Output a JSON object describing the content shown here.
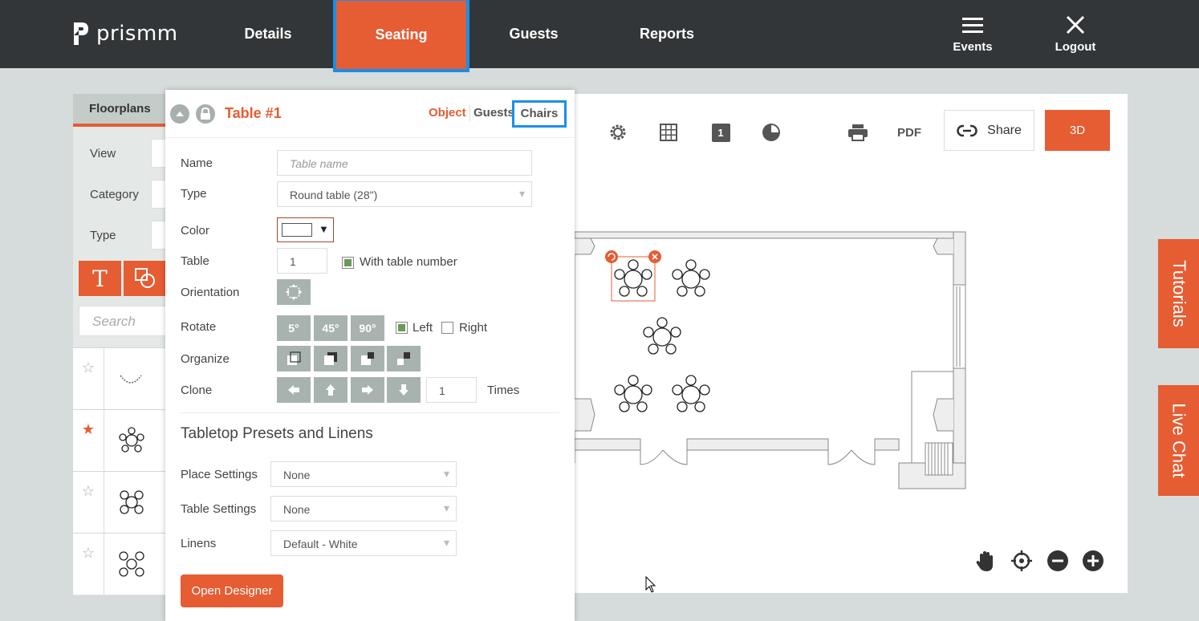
{
  "app": {
    "logo": "prismm"
  },
  "nav": {
    "tabs": [
      "Details",
      "Seating",
      "Guests",
      "Reports"
    ],
    "events": "Events",
    "logout": "Logout"
  },
  "left": {
    "title": "Floorplans",
    "view_label": "View",
    "category_label": "Category",
    "type_label": "Type",
    "search_placeholder": "Search"
  },
  "canvas": {
    "pdf": "PDF",
    "share": "Share",
    "btn_3d": "3D",
    "page_badge": "1"
  },
  "side_tabs": {
    "tutorials": "Tutorials",
    "live_chat": "Live Chat"
  },
  "props": {
    "title": "Table #1",
    "tabs": {
      "object": "Object",
      "guests": "Guests",
      "chairs": "Chairs"
    },
    "name_label": "Name",
    "name_placeholder": "Table name",
    "type_label": "Type",
    "type_value": "Round table (28\")",
    "color_label": "Color",
    "table_label": "Table",
    "table_number": "1",
    "with_table_number": "With table number",
    "orientation_label": "Orientation",
    "rotate_label": "Rotate",
    "rotate_5": "5°",
    "rotate_45": "45°",
    "rotate_90": "90°",
    "left": "Left",
    "right": "Right",
    "organize_label": "Organize",
    "clone_label": "Clone",
    "clone_times_value": "1",
    "times": "Times",
    "presets_title": "Tabletop Presets and Linens",
    "place_settings_label": "Place Settings",
    "place_settings_value": "None",
    "table_settings_label": "Table Settings",
    "table_settings_value": "None",
    "linens_label": "Linens",
    "linens_value": "Default - White",
    "open_designer": "Open Designer"
  },
  "colors": {
    "accent": "#e65c33",
    "highlight": "#1a8fe8",
    "nav_bg": "#333638",
    "grey_btn": "#a8b3b0"
  }
}
